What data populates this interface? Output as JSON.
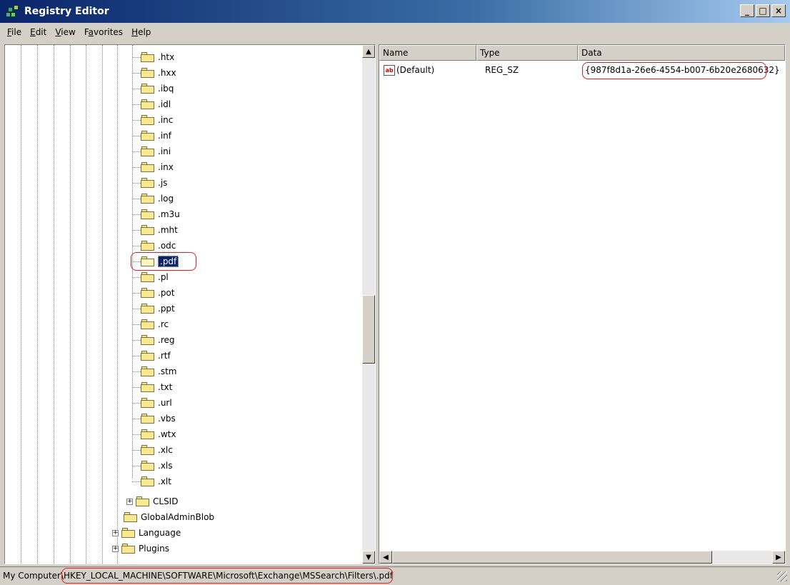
{
  "window": {
    "title": "Registry Editor"
  },
  "window_controls": {
    "minimize": "_",
    "maximize": "□",
    "close": "×"
  },
  "menu": [
    {
      "label": "File",
      "accel": "F",
      "rest": "ile"
    },
    {
      "label": "Edit",
      "accel": "E",
      "rest": "dit"
    },
    {
      "label": "View",
      "accel": "V",
      "rest": "iew"
    },
    {
      "label": "Favorites",
      "accel": "a",
      "pre": "F",
      "rest": "vorites"
    },
    {
      "label": "Help",
      "accel": "H",
      "rest": "elp"
    }
  ],
  "tree": {
    "items": [
      {
        "label": ".htx"
      },
      {
        "label": ".hxx"
      },
      {
        "label": ".ibq"
      },
      {
        "label": ".idl"
      },
      {
        "label": ".inc"
      },
      {
        "label": ".inf"
      },
      {
        "label": ".ini"
      },
      {
        "label": ".inx"
      },
      {
        "label": ".js"
      },
      {
        "label": ".log"
      },
      {
        "label": ".m3u"
      },
      {
        "label": ".mht"
      },
      {
        "label": ".odc"
      },
      {
        "label": ".pdf",
        "selected": true
      },
      {
        "label": ".pl"
      },
      {
        "label": ".pot"
      },
      {
        "label": ".ppt"
      },
      {
        "label": ".rc"
      },
      {
        "label": ".reg"
      },
      {
        "label": ".rtf"
      },
      {
        "label": ".stm"
      },
      {
        "label": ".txt"
      },
      {
        "label": ".url"
      },
      {
        "label": ".vbs"
      },
      {
        "label": ".wtx"
      },
      {
        "label": ".xlc"
      },
      {
        "label": ".xls"
      },
      {
        "label": ".xlt"
      }
    ],
    "clsid": "CLSID",
    "globaladminblob": "GlobalAdminBlob",
    "language": "Language",
    "plugins": "Plugins"
  },
  "list": {
    "columns": {
      "name": "Name",
      "type": "Type",
      "data": "Data"
    },
    "rows": [
      {
        "name": "(Default)",
        "type": "REG_SZ",
        "data": "{987f8d1a-26e6-4554-b007-6b20e2680632}",
        "icon": "string-value-icon"
      }
    ]
  },
  "status": {
    "prefix": "My Computer",
    "path": "\\HKEY_LOCAL_MACHINE\\SOFTWARE\\Microsoft\\Exchange\\MSSearch\\Filters\\.pdf"
  },
  "colors": {
    "selection": "#0a246a",
    "annotation": "#e02020",
    "titlebar_start": "#0a246a"
  }
}
